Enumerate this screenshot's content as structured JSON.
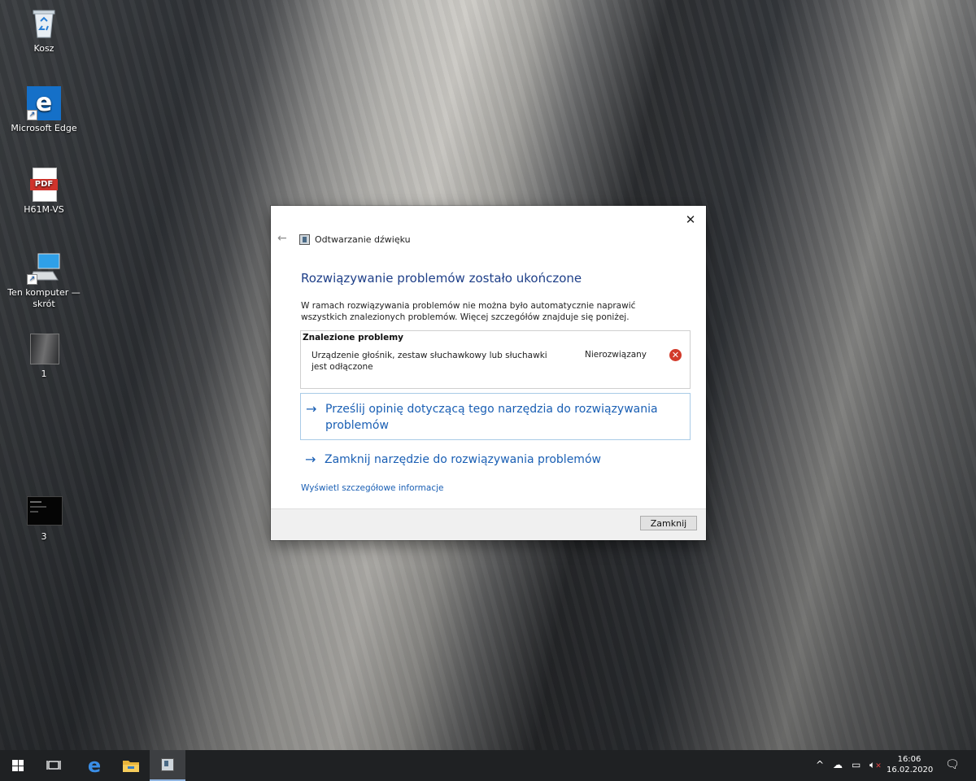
{
  "desktop": {
    "icons": [
      {
        "label": "Kosz",
        "icon": "recycle-bin-icon"
      },
      {
        "label": "Microsoft Edge",
        "icon": "edge-icon"
      },
      {
        "label": "H61M-VS",
        "icon": "pdf-file-icon",
        "badge": "PDF"
      },
      {
        "label": "Ten komputer — skrót",
        "icon": "this-pc-icon"
      },
      {
        "label": "1",
        "icon": "image-file-icon"
      },
      {
        "label": "3",
        "icon": "terminal-image-icon"
      }
    ]
  },
  "dialog": {
    "window_title": "Odtwarzanie dźwięku",
    "heading": "Rozwiązywanie problemów zostało ukończone",
    "description": "W ramach rozwiązywania problemów nie można było automatycznie naprawić wszystkich znalezionych problemów. Więcej szczegółów znajduje się poniżej.",
    "problems": {
      "header": "Znalezione problemy",
      "items": [
        {
          "text": "Urządzenie głośnik, zestaw słuchawkowy lub słuchawki jest odłączone",
          "status": "Nierozwiązany"
        }
      ]
    },
    "commands": [
      "Prześlij opinię dotyczącą tego narzędzia do rozwiązywania problemów",
      "Zamknij narzędzie do rozwiązywania problemów"
    ],
    "details_link": "Wyświetl szczegółowe informacje",
    "close_button": "Zamknij"
  },
  "taskbar": {
    "clock_time": "16:06",
    "clock_date": "16.02.2020"
  },
  "colors": {
    "accent_link": "#1a5fb4",
    "heading": "#1e3f88",
    "error": "#d23a2a",
    "taskbar": "#1f2123"
  }
}
